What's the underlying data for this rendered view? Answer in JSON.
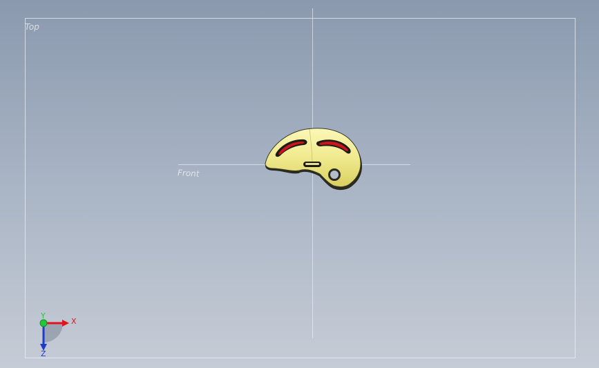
{
  "viewport": {
    "planes": {
      "top_label": "Top",
      "front_label": "Front"
    },
    "model": {
      "name": "helmet-shell",
      "shell_color": "#f0ec90",
      "vent_color": "#c8141e"
    },
    "triad": {
      "x_label": "X",
      "y_label": "Y",
      "z_label": "Z",
      "x_color": "#e0141e",
      "y_color": "#22c83a",
      "z_color": "#1e3cc8"
    },
    "background": {
      "top_color": "#8a99ae",
      "bottom_color": "#c6ccd6"
    }
  }
}
